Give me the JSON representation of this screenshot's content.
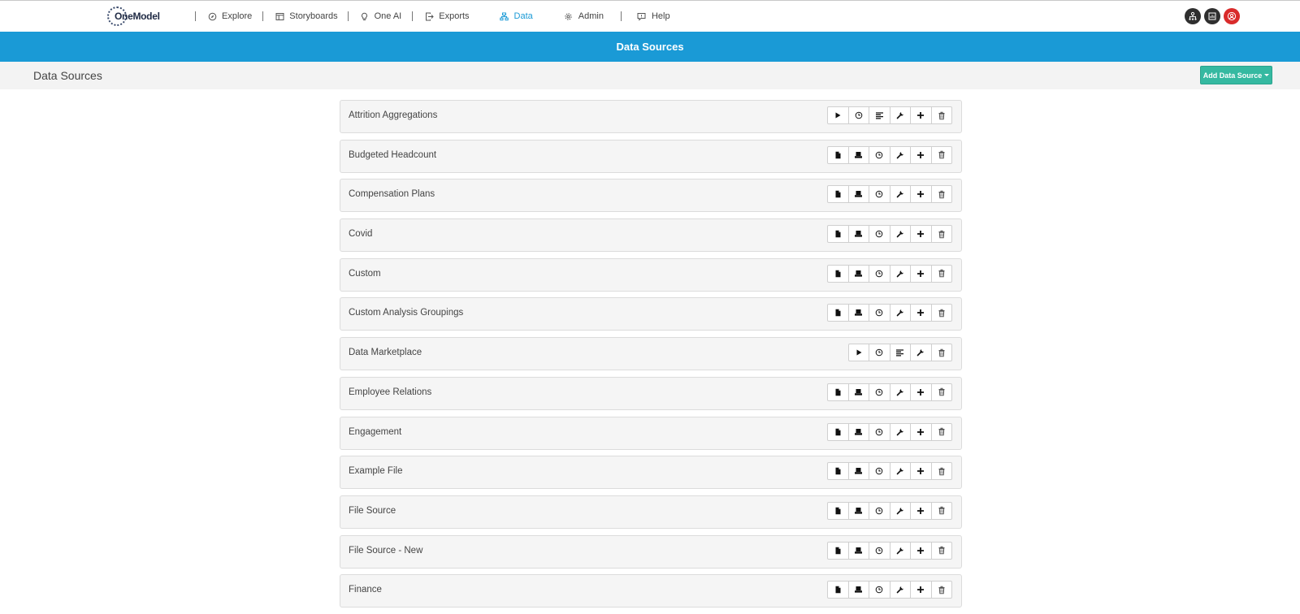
{
  "brand": {
    "logo_text": "OneModel"
  },
  "nav": {
    "items": [
      {
        "label": "Explore",
        "icon": "compass-icon",
        "active": false
      },
      {
        "label": "Storyboards",
        "icon": "storyboard-icon",
        "active": false
      },
      {
        "label": "One AI",
        "icon": "bulb-icon",
        "active": false
      },
      {
        "label": "Exports",
        "icon": "export-icon",
        "active": false
      },
      {
        "label": "Data",
        "icon": "data-icon",
        "active": true
      },
      {
        "label": "Admin",
        "icon": "gear-icon",
        "active": false
      },
      {
        "label": "Help",
        "icon": "help-icon",
        "active": false
      }
    ],
    "user_icons": [
      "org-chart-icon",
      "report-icon",
      "user-icon"
    ]
  },
  "banner": {
    "title": "Data Sources"
  },
  "subheader": {
    "title": "Data Sources",
    "add_button_label": "Add Data Source"
  },
  "colors": {
    "accent": "#1a9ad6",
    "add_button": "#35b9a1",
    "user_badge": "#d92b2b"
  },
  "data_sources": [
    {
      "name": "Attrition Aggregations",
      "actions": [
        "play-icon",
        "clock-icon",
        "list-icon",
        "wrench-icon",
        "plus-icon",
        "trash-icon"
      ]
    },
    {
      "name": "Budgeted Headcount",
      "actions": [
        "file-icon",
        "stack-icon",
        "clock-icon",
        "wrench-icon",
        "plus-icon",
        "trash-icon"
      ]
    },
    {
      "name": "Compensation Plans",
      "actions": [
        "file-icon",
        "stack-icon",
        "clock-icon",
        "wrench-icon",
        "plus-icon",
        "trash-icon"
      ]
    },
    {
      "name": "Covid",
      "actions": [
        "file-icon",
        "stack-icon",
        "clock-icon",
        "wrench-icon",
        "plus-icon",
        "trash-icon"
      ]
    },
    {
      "name": "Custom",
      "actions": [
        "file-icon",
        "stack-icon",
        "clock-icon",
        "wrench-icon",
        "plus-icon",
        "trash-icon"
      ]
    },
    {
      "name": "Custom Analysis Groupings",
      "actions": [
        "file-icon",
        "stack-icon",
        "clock-icon",
        "wrench-icon",
        "plus-icon",
        "trash-icon"
      ]
    },
    {
      "name": "Data Marketplace",
      "actions": [
        "play-icon",
        "clock-icon",
        "list-icon",
        "wrench-icon",
        "trash-icon"
      ]
    },
    {
      "name": "Employee Relations",
      "actions": [
        "file-icon",
        "stack-icon",
        "clock-icon",
        "wrench-icon",
        "plus-icon",
        "trash-icon"
      ]
    },
    {
      "name": "Engagement",
      "actions": [
        "file-icon",
        "stack-icon",
        "clock-icon",
        "wrench-icon",
        "plus-icon",
        "trash-icon"
      ]
    },
    {
      "name": "Example File",
      "actions": [
        "file-icon",
        "stack-icon",
        "clock-icon",
        "wrench-icon",
        "plus-icon",
        "trash-icon"
      ]
    },
    {
      "name": "File Source",
      "actions": [
        "file-icon",
        "stack-icon",
        "clock-icon",
        "wrench-icon",
        "plus-icon",
        "trash-icon"
      ]
    },
    {
      "name": "File Source - New",
      "actions": [
        "file-icon",
        "stack-icon",
        "clock-icon",
        "wrench-icon",
        "plus-icon",
        "trash-icon"
      ]
    },
    {
      "name": "Finance",
      "actions": [
        "file-icon",
        "stack-icon",
        "clock-icon",
        "wrench-icon",
        "plus-icon",
        "trash-icon"
      ]
    }
  ]
}
